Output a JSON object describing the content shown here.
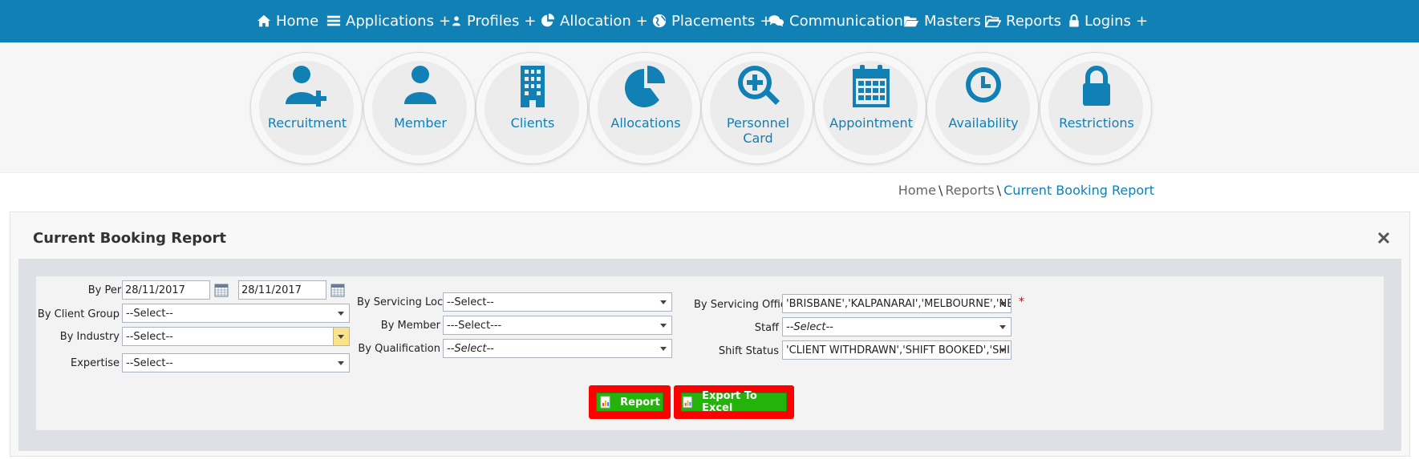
{
  "nav": {
    "home": "Home",
    "applications": "Applications",
    "profiles": "Profiles",
    "allocation": "Allocation",
    "placements": "Placements",
    "communication": "Communication",
    "masters": "Masters",
    "reports": "Reports",
    "logins": "Logins",
    "plus": "+"
  },
  "tiles": {
    "recruitment": "Recruitment",
    "member": "Member",
    "clients": "Clients",
    "allocations": "Allocations",
    "personnel_card_1": "Personnel",
    "personnel_card_2": "Card",
    "appointment": "Appointment",
    "availability": "Availability",
    "restrictions": "Restrictions"
  },
  "breadcrumb": {
    "home": "Home",
    "sep": "\\",
    "reports": "Reports",
    "current": "Current Booking Report"
  },
  "panel": {
    "title": "Current Booking Report"
  },
  "form": {
    "by_period_label": "By Period",
    "date_from": "28/11/2017",
    "date_to": "28/11/2017",
    "by_client_group_label": "By Client Group",
    "client_group_value": "--Select--",
    "by_industry_label": "By Industry",
    "industry_value": "--Select--",
    "expertise_label": "Expertise",
    "expertise_value": "--Select--",
    "by_servicing_location_label": "By Servicing Location",
    "servicing_location_value": "--Select--",
    "by_member_label": "By Member",
    "member_value": "---Select---",
    "by_qualification_label": "By Qualification",
    "qualification_value": "--Select--",
    "by_servicing_office_label": "By Servicing Office",
    "servicing_office_value": "'BRISBANE','KALPANARAI','MELBOURNE','NE",
    "required_mark": "*",
    "staff_label": "Staff",
    "staff_value": "--Select--",
    "shift_status_label": "Shift Status",
    "shift_status_value": "'CLIENT WITHDRAWN','SHIFT BOOKED','SHIF"
  },
  "buttons": {
    "report": "Report",
    "export": "Export To Excel"
  },
  "colors": {
    "brand": "#1080b5",
    "button_green": "#24b30b",
    "highlight_red": "#ff0000"
  }
}
